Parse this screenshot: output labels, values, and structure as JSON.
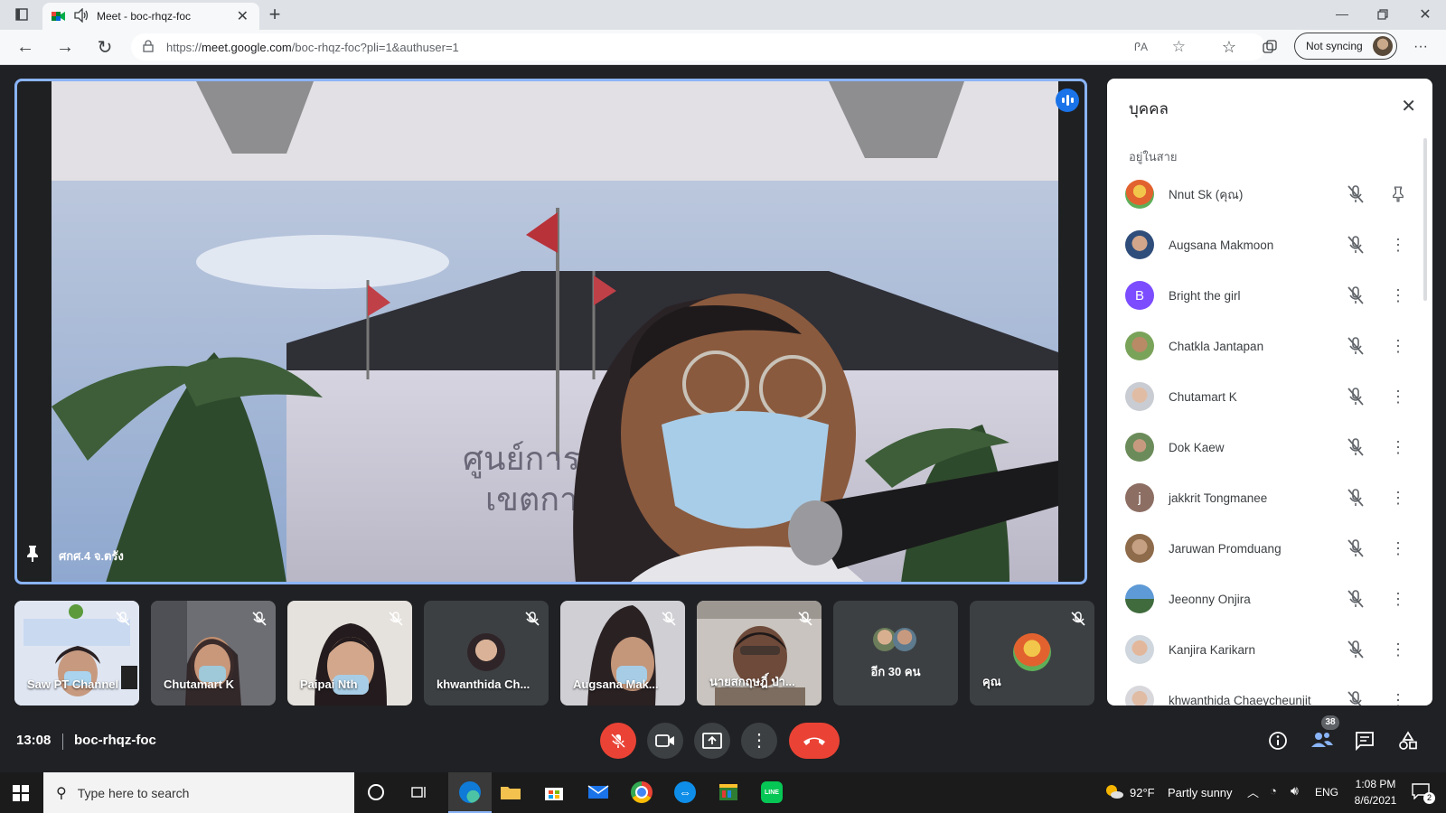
{
  "browser": {
    "tab_title": "Meet - boc-rhqz-foc",
    "url_prefix": "https://",
    "url_host": "meet.google.com",
    "url_path": "/boc-rhqz-foc?pli=1&authuser=1",
    "sync_label": "Not syncing",
    "translate_glyph": "ᎵA"
  },
  "stage": {
    "speaker_name": "ศกศ.4 จ.ตรัง",
    "sign_line1": "ศูนย์การศึ",
    "sign_line2": "เขตการศึ"
  },
  "tiles": [
    {
      "name": "Saw PT Channel"
    },
    {
      "name": "Chutamart K"
    },
    {
      "name": "Paipai Nth"
    },
    {
      "name": "khwanthida Ch..."
    },
    {
      "name": "Augsana Mak..."
    },
    {
      "name": "นายสกฤษฎิ์ ป่า..."
    },
    {
      "name": "อีก 30 คน"
    },
    {
      "name": "คุณ"
    }
  ],
  "panel": {
    "title": "บุคคล",
    "section": "อยู่ในสาย",
    "people": [
      {
        "name": "Nnut Sk (คุณ)",
        "initial": ""
      },
      {
        "name": "Augsana Makmoon",
        "initial": ""
      },
      {
        "name": "Bright the girl",
        "initial": "B"
      },
      {
        "name": "Chatkla Jantapan",
        "initial": ""
      },
      {
        "name": "Chutamart K",
        "initial": ""
      },
      {
        "name": "Dok Kaew",
        "initial": ""
      },
      {
        "name": "jakkrit Tongmanee",
        "initial": "j"
      },
      {
        "name": "Jaruwan Promduang",
        "initial": ""
      },
      {
        "name": "Jeeonny Onjira",
        "initial": ""
      },
      {
        "name": "Kanjira Karikarn",
        "initial": ""
      },
      {
        "name": "khwanthida Chaeycheunjit",
        "initial": ""
      }
    ]
  },
  "meeting": {
    "time": "13:08",
    "code": "boc-rhqz-foc",
    "participant_count": "38"
  },
  "taskbar": {
    "search_placeholder": "Type here to search",
    "temperature": "92°F",
    "weather": "Partly sunny",
    "lang": "ENG",
    "clock_time": "1:08 PM",
    "clock_date": "8/6/2021",
    "notif_count": "2"
  },
  "colors": {
    "accent_blue": "#8ab4f8",
    "meet_red": "#ea4335",
    "dark_bg": "#202124",
    "tile_bg": "#3c4043"
  }
}
